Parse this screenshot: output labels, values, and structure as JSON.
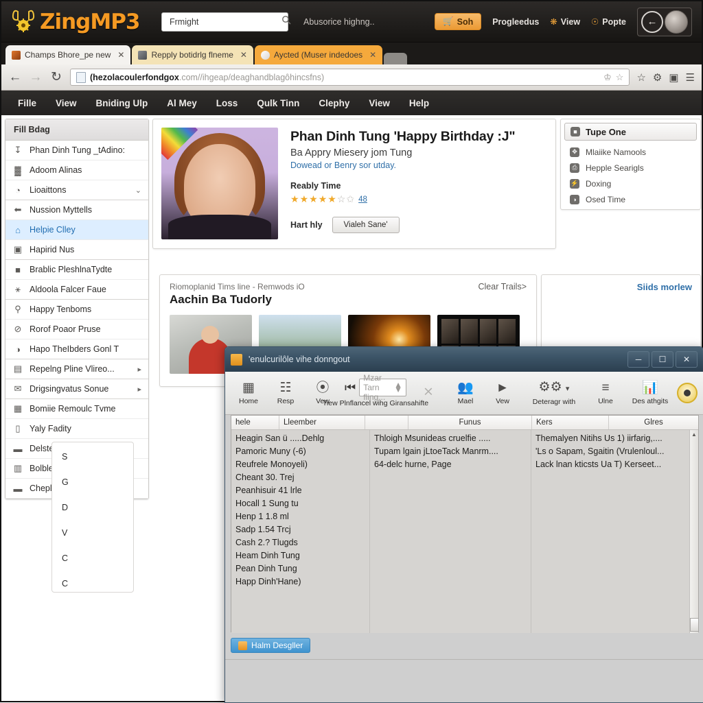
{
  "site": {
    "brand": "ZingMP3",
    "brand_accent": "#f59a23",
    "search_value": "Frmight",
    "search_placeholder": "Frmight",
    "header_note": "Abusorice highng..",
    "cta_label": "Soh",
    "links": [
      {
        "label": "Progleedus",
        "icon": ""
      },
      {
        "label": "View",
        "icon": "puzzle-icon"
      },
      {
        "label": "Popte",
        "icon": "badge-icon"
      }
    ]
  },
  "browser": {
    "tabs": [
      {
        "label": "Champs Bhore_pe new",
        "state": "active"
      },
      {
        "label": "Repply botidrlg flneme",
        "state": "inactive"
      },
      {
        "label": "Aycted (Muser indedoes",
        "state": "highlight"
      }
    ],
    "url_bold": "(hezolacoulerfondgox",
    "url_rest": ".com//ihgeap/deaghandblagôhincsfns)"
  },
  "menubar": [
    "Fille",
    "View",
    "Bniding Ulp",
    "Al Mey",
    "Loss",
    "Qulk Tinn",
    "Clephy",
    "View",
    "Help"
  ],
  "sidebar": {
    "header": "Fill Bdag",
    "items": [
      {
        "label": "Phan Dinh Tung _tAdino:",
        "icon": "download-icon",
        "state": "normal",
        "chevron": false
      },
      {
        "label": "Adoom Alinas",
        "icon": "grid-icon",
        "state": "normal",
        "chevron": false
      },
      {
        "label": "Lioaittons",
        "icon": "globe-icon",
        "state": "normal",
        "chevron": true
      },
      {
        "label": "Nussion Myttells",
        "icon": "back-arrow-icon",
        "state": "normal",
        "chevron": false
      },
      {
        "label": "Helpie Clley",
        "icon": "home-icon",
        "state": "selected",
        "chevron": false
      },
      {
        "label": "Hapirid Nus",
        "icon": "image-icon",
        "state": "normal",
        "chevron": false
      },
      {
        "label": "Brablic PleshlnaTydte",
        "icon": "lock-icon",
        "state": "normal",
        "chevron": false
      },
      {
        "label": "Aldoola Falcer Faue",
        "icon": "person-icon",
        "state": "normal",
        "chevron": false
      },
      {
        "label": "Happy Tenboms",
        "icon": "search-icon",
        "state": "normal",
        "chevron": false
      },
      {
        "label": "Rorof Poaor Pruse",
        "icon": "tag-icon",
        "state": "normal",
        "chevron": false
      },
      {
        "label": "Hapo TheIbders Gonl T",
        "icon": "clock-icon",
        "state": "normal",
        "chevron": false
      },
      {
        "label": "Repelng Pline Vlireo...",
        "icon": "video-icon",
        "state": "normal",
        "chevron": true
      },
      {
        "label": "Drigsingvatus Sonue",
        "icon": "mail-icon",
        "state": "normal",
        "chevron": true
      },
      {
        "label": "Bomiie Remoulc Tvme",
        "icon": "calendar-icon",
        "state": "normal",
        "chevron": false
      },
      {
        "label": "Yaly Fadity",
        "icon": "device-icon",
        "state": "normal",
        "chevron": false
      },
      {
        "label": "Delstems",
        "icon": "folder-icon",
        "state": "normal",
        "chevron": false
      },
      {
        "label": "Bolble",
        "icon": "photo-icon",
        "state": "normal",
        "chevron": false
      },
      {
        "label": "Cheply",
        "icon": "folder-icon",
        "state": "normal",
        "chevron": false
      }
    ]
  },
  "hero": {
    "title": "Phan Dinh Tung 'Happy Birthday :J\"",
    "subtitle": "Ba Appry Miesery jom Tung",
    "link": "Dowead or Benry sor utday.",
    "rating_label": "Reably Time",
    "rating_value": 4.5,
    "rating_count": "48",
    "action_label": "Hart hly",
    "action_button": "Vialeh Sane'"
  },
  "right_panel": {
    "selected": "Tupe One",
    "selected_icon": "folder-icon",
    "items": [
      {
        "label": "Mlaiike Namools",
        "icon": "move-icon"
      },
      {
        "label": "Hepple Searigls",
        "icon": "printer-icon"
      },
      {
        "label": "Doxing",
        "icon": "bolt-icon"
      },
      {
        "label": "Osed Time",
        "icon": "clock-icon"
      }
    ]
  },
  "timeline": {
    "eyebrow": "Riomoplanid Tims line - Remwods iO",
    "title": "Aachin Ba Tudorly",
    "clear_label": "Clear Trails>",
    "thumbs": [
      "thumb-red-host",
      "thumb-outdoor-person",
      "thumb-fire-night",
      "thumb-dark-collage"
    ]
  },
  "side_right_card": {
    "link": "Siids morlew"
  },
  "hidden_form": {
    "lines": [
      "S",
      "G",
      "D",
      "V",
      "C",
      "C"
    ]
  },
  "dialog": {
    "title": "'enulcurilôle vihe donngout",
    "window_buttons": [
      "minimize-button",
      "maximize-button",
      "close-button"
    ],
    "toolbar": [
      {
        "label": "Home",
        "icon": "home-panel-icon",
        "dim": false
      },
      {
        "label": "Resp",
        "icon": "grid-panel-icon",
        "dim": false
      },
      {
        "label": "Vew",
        "icon": "info-circle-icon",
        "dim": false
      }
    ],
    "field": {
      "icon": "skip-icon",
      "placeholder": "Mzar Tarn fling...",
      "label": "Tiew Plnflancel wihg Giransahifte"
    },
    "toolbar_right": [
      {
        "label": "",
        "icon": "filter-off-icon",
        "dim": true
      },
      {
        "label": "Mael",
        "icon": "people-icon",
        "dim": false
      },
      {
        "label": "Vew",
        "icon": "play-icon",
        "dim": false
      },
      {
        "label": "Deteragr with",
        "icon": "gear-icon",
        "dim": false
      },
      {
        "label": "Ulne",
        "icon": "list-icon",
        "dim": false
      },
      {
        "label": "Des athgits",
        "icon": "chart-icon",
        "dim": false
      }
    ],
    "table": {
      "headers": [
        "hele",
        "Lleember",
        "",
        "Funus",
        "Kers",
        "Glres"
      ],
      "col1": [
        "Heagin San ü .....Dehlg",
        "Pamoric Muny (-6)",
        "Reufrele Monoyeli)",
        "Cheant 30. Trej",
        "Peanhisuir 41 lrle",
        "Hocall 1 Sung tu",
        "Henp 1 1.8 ml",
        "Sadp 1.54 Trcj",
        "Cash 2.? Tlugds",
        "Heam Dinh Tung",
        "Pean Dinh Tung",
        "Happ Dinh'Hane)"
      ],
      "col2": [
        "Thloigh Msunideas cruelfie .....",
        "Tupam lgain jLtoeTack Manrm....",
        "64-delc hurne, Page"
      ],
      "col3": [
        "Themalyen Nitihs Us 1) iirfarig,....",
        "'Ls o Sapam, Sgaitin (Vrulenloul...",
        "Lack lnan kticsts Ua T) Kerseet..."
      ]
    },
    "footer_button": "Halm Desgller"
  }
}
